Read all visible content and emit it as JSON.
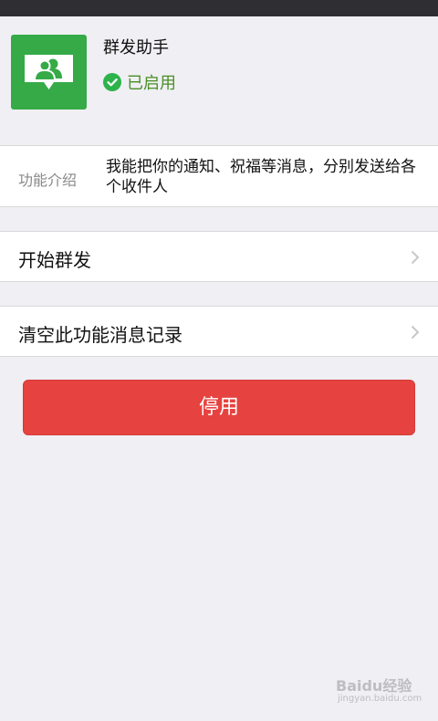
{
  "navbar": {
    "back_label": "",
    "title": ""
  },
  "header": {
    "app_name": "群发助手",
    "status": "已启用"
  },
  "info": {
    "label": "功能介绍",
    "description": "我能把你的通知、祝福等消息，分别发送给各个收件人"
  },
  "rows": [
    {
      "label": "开始群发"
    },
    {
      "label": "清空此功能消息记录"
    }
  ],
  "stop_button": {
    "label": "停用"
  },
  "watermark": {
    "line1": "Baidu经验",
    "line2": "jingyan.baidu.com"
  },
  "colors": {
    "icon_bg": "#35aa47",
    "enabled_text": "#4a8f25",
    "stop_button": "#e64340"
  }
}
